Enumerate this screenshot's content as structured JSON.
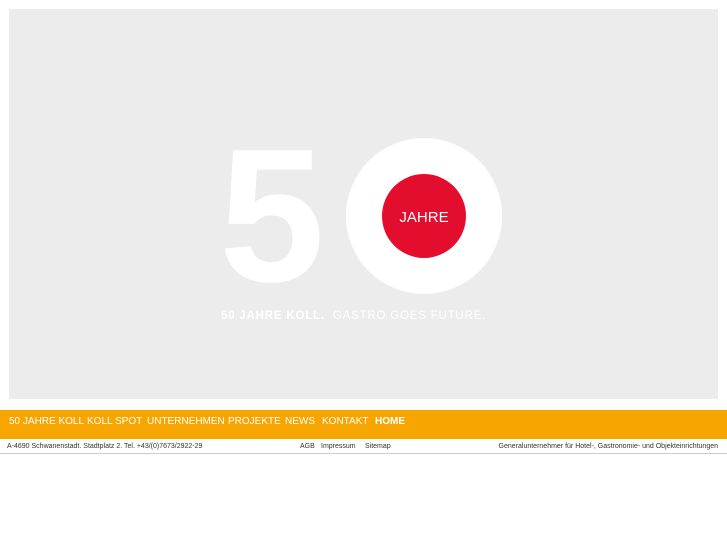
{
  "hero": {
    "big_number": "50",
    "badge_text": "JAHRE",
    "tagline_bold": "50 JAHRE KOLL.",
    "tagline_light": "GASTRO GOES FUTURE.",
    "colors": {
      "background": "#ececec",
      "badge": "#e30e2d",
      "numerals": "#ffffff"
    }
  },
  "nav": {
    "items": [
      {
        "label": "50 JAHRE KOLL"
      },
      {
        "label": "KOLL SPOT"
      },
      {
        "label": "UNTERNEHMEN"
      },
      {
        "label": "PROJEKTE"
      },
      {
        "label": "NEWS"
      },
      {
        "label": "KONTAKT"
      },
      {
        "label": "HOME",
        "active": true
      }
    ],
    "color": "#f7a600"
  },
  "footer": {
    "address": "A-4690 Schwanenstadt. Stadtplatz 2. Tel. +43/(0)7673/2922-29",
    "links": [
      {
        "label": "AGB"
      },
      {
        "label": "Impressum"
      },
      {
        "label": "Sitemap"
      }
    ],
    "tagline": "Generalunternehmer für Hotel-, Gastronomie- und Objekteinrichtungen"
  }
}
